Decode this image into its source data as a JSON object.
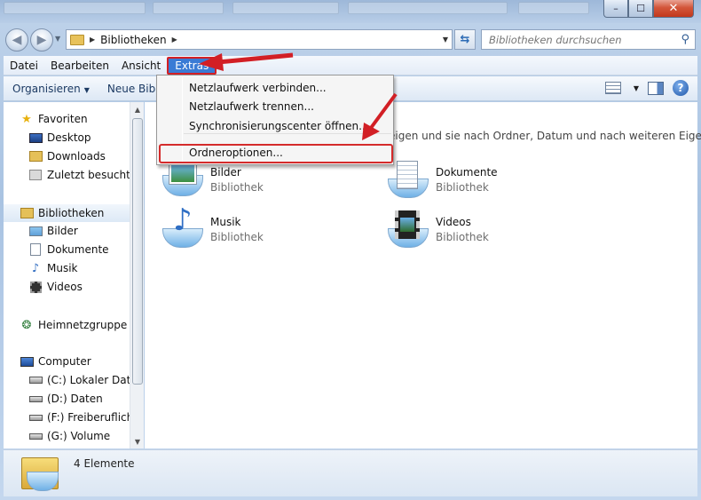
{
  "window": {
    "controls": {
      "minimize": "–",
      "maximize": "☐",
      "close": "✕"
    }
  },
  "address": {
    "breadcrumb": "Bibliotheken",
    "search_placeholder": "Bibliotheken durchsuchen"
  },
  "menubar": {
    "items": [
      "Datei",
      "Bearbeiten",
      "Ansicht",
      "Extras"
    ],
    "active": "Extras"
  },
  "toolbar": {
    "organize": "Organisieren",
    "new_library": "Neue Bib"
  },
  "extras_menu": {
    "items": [
      "Netzlaufwerk verbinden...",
      "Netzlaufwerk trennen...",
      "Synchronisierungscenter öffnen...",
      "Ordneroptionen..."
    ],
    "highlighted": "Ordneroptionen..."
  },
  "nav": {
    "favorites": "Favoriten",
    "fav_items": [
      "Desktop",
      "Downloads",
      "Zuletzt besucht"
    ],
    "libraries": "Bibliotheken",
    "lib_items": [
      "Bilder",
      "Dokumente",
      "Musik",
      "Videos"
    ],
    "homegroup": "Heimnetzgruppe",
    "computer": "Computer",
    "drives": [
      "(C:) Lokaler Daten",
      "(D:) Daten",
      "(F:) Freiberufliche",
      "(G:) Volume"
    ]
  },
  "content": {
    "description": "eigen und sie nach Ordner, Datum und nach weiteren Eige...",
    "libraries": [
      {
        "name": "Bilder",
        "type": "Bibliothek",
        "icon": "pictures-library-icon"
      },
      {
        "name": "Dokumente",
        "type": "Bibliothek",
        "icon": "documents-library-icon"
      },
      {
        "name": "Musik",
        "type": "Bibliothek",
        "icon": "music-library-icon"
      },
      {
        "name": "Videos",
        "type": "Bibliothek",
        "icon": "videos-library-icon"
      }
    ]
  },
  "status": {
    "count": "4 Elemente"
  },
  "colors": {
    "annotation_red": "#d21f25",
    "menu_active": "#3a7bd5"
  }
}
